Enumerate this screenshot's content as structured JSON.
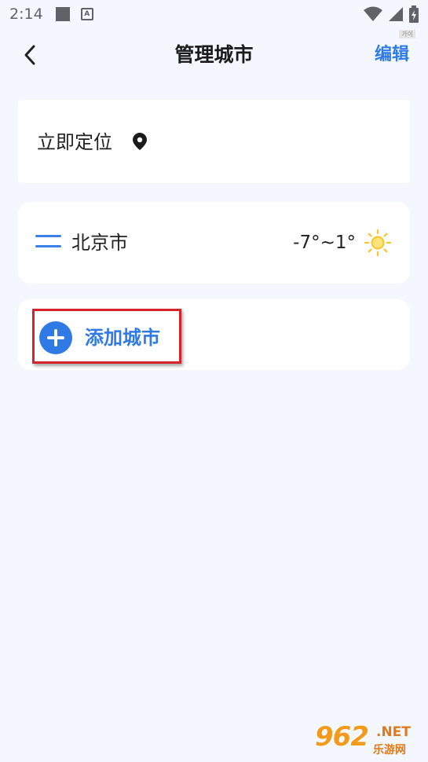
{
  "status_bar": {
    "time": "2:14",
    "icons": [
      "square-notification-icon",
      "a-notification-icon",
      "wifi-icon",
      "signal-icon",
      "battery-icon"
    ]
  },
  "header": {
    "title": "管理城市",
    "edit_label": "编辑",
    "tag": "가이",
    "back_icon": "chevron-left-icon"
  },
  "locate": {
    "label": "立即定位",
    "icon": "location-pin-icon"
  },
  "cities": [
    {
      "name": "北京市",
      "temp": "-7°~1°",
      "weather_icon": "sun-icon"
    }
  ],
  "add_city": {
    "label": "添加城市",
    "icon": "plus-circle-icon"
  },
  "watermark": {
    "number": "962",
    "suffix": ".NET",
    "sub": "乐游网"
  },
  "colors": {
    "accent": "#2f7ae5",
    "background": "#f4f7fd",
    "highlight_border": "#d6222a",
    "sun": "#f9c528"
  }
}
